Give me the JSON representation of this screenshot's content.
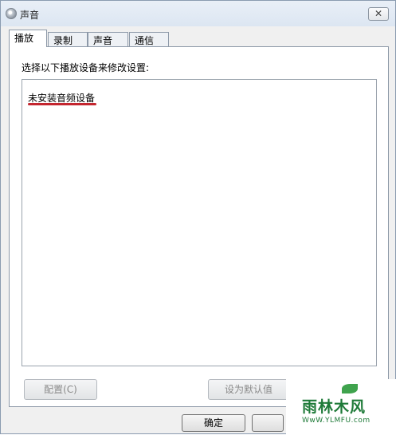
{
  "window": {
    "title": "声音",
    "close_label": "✕"
  },
  "tabs": [
    {
      "label": "播放",
      "active": true
    },
    {
      "label": "录制",
      "active": false
    },
    {
      "label": "声音",
      "active": false
    },
    {
      "label": "通信",
      "active": false
    }
  ],
  "playback": {
    "instruction": "选择以下播放设备来修改设置:",
    "empty_message": "未安装音频设备"
  },
  "buttons": {
    "configure": "配置(C)",
    "set_default": "设为默认值",
    "ok": "确定"
  },
  "watermark": {
    "brand": "雨林木风",
    "url": "WwW.YLMFU.com"
  },
  "colors": {
    "underline": "#c4262f",
    "watermark": "#1e7a38"
  }
}
